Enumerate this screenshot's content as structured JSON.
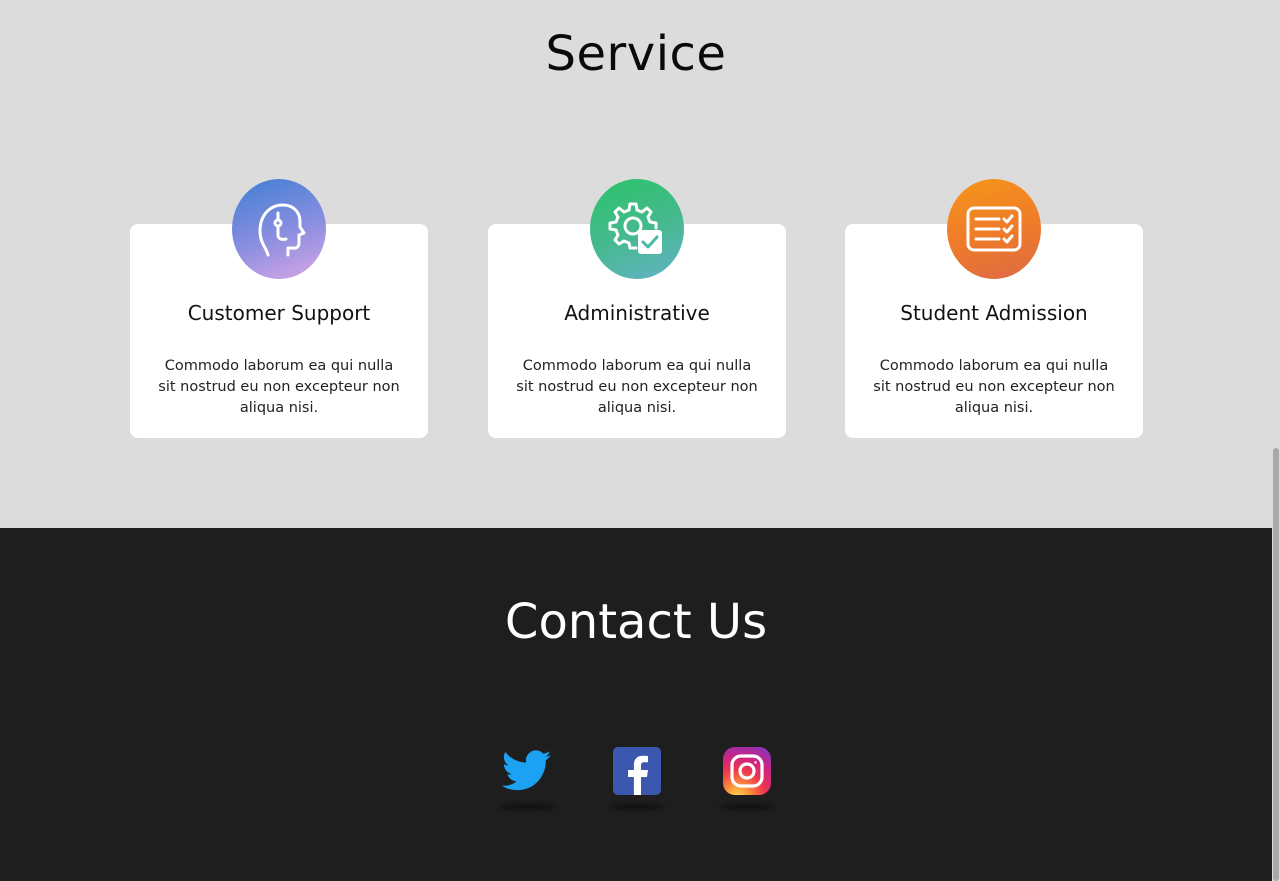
{
  "service": {
    "title": "Service",
    "cards": [
      {
        "title": "Customer Support",
        "text": "Commodo laborum ea qui nulla sit nostrud eu non excepteur non aliqua nisi.",
        "icon": "headset-head-icon"
      },
      {
        "title": "Administrative",
        "text": "Commodo laborum ea qui nulla sit nostrud eu non excepteur non aliqua nisi.",
        "icon": "gear-check-icon"
      },
      {
        "title": "Student Admission",
        "text": "Commodo laborum ea qui nulla sit nostrud eu non excepteur non aliqua nisi.",
        "icon": "checklist-form-icon"
      }
    ]
  },
  "contact": {
    "title": "Contact Us",
    "socials": [
      {
        "icon": "twitter-icon",
        "color": "#1da1f2"
      },
      {
        "icon": "facebook-icon",
        "color": "#3b57b0"
      },
      {
        "icon": "instagram-icon",
        "color": "#e1306c"
      }
    ]
  },
  "colors": {
    "service_bg": "#dcdcdc",
    "contact_bg": "#1e1e1e",
    "card_bg": "#ffffff"
  }
}
